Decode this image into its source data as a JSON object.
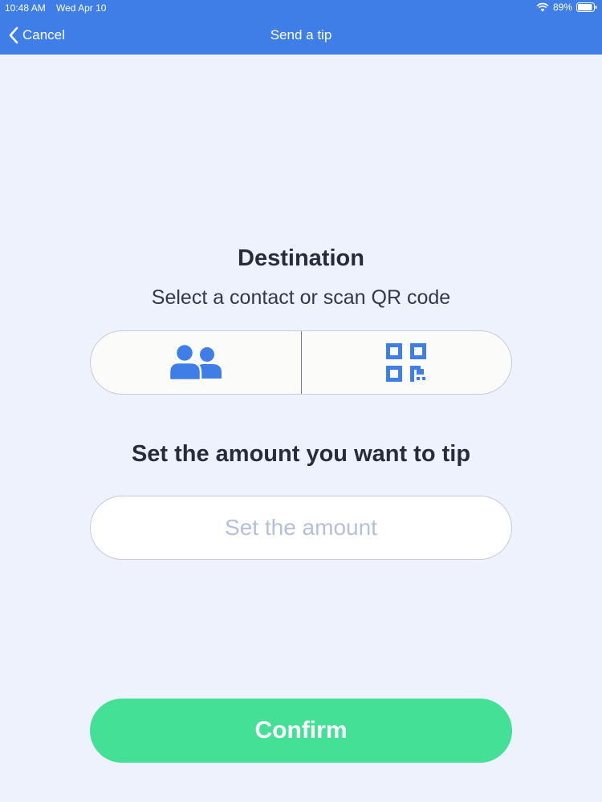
{
  "status_bar": {
    "time": "10:48 AM",
    "date": "Wed Apr 10",
    "battery": "89%",
    "icons": [
      "wifi-icon",
      "battery-icon"
    ]
  },
  "nav": {
    "cancel_label": "Cancel",
    "title": "Send a tip",
    "back_icon": "chevron-left-icon"
  },
  "destination": {
    "title": "Destination",
    "subtitle": "Select a contact or scan QR code",
    "options": [
      {
        "icon": "contacts-icon"
      },
      {
        "icon": "qr-code-icon"
      }
    ]
  },
  "amount": {
    "title": "Set the amount you want to tip",
    "value": "",
    "placeholder": "Set the amount"
  },
  "confirm": {
    "label": "Confirm"
  },
  "colors": {
    "header": "#3e7ee6",
    "background": "#eef2fd",
    "icon": "#3e7ee6",
    "confirm": "#43e096",
    "title_text": "#272c3a",
    "placeholder": "#b4bfdb"
  }
}
